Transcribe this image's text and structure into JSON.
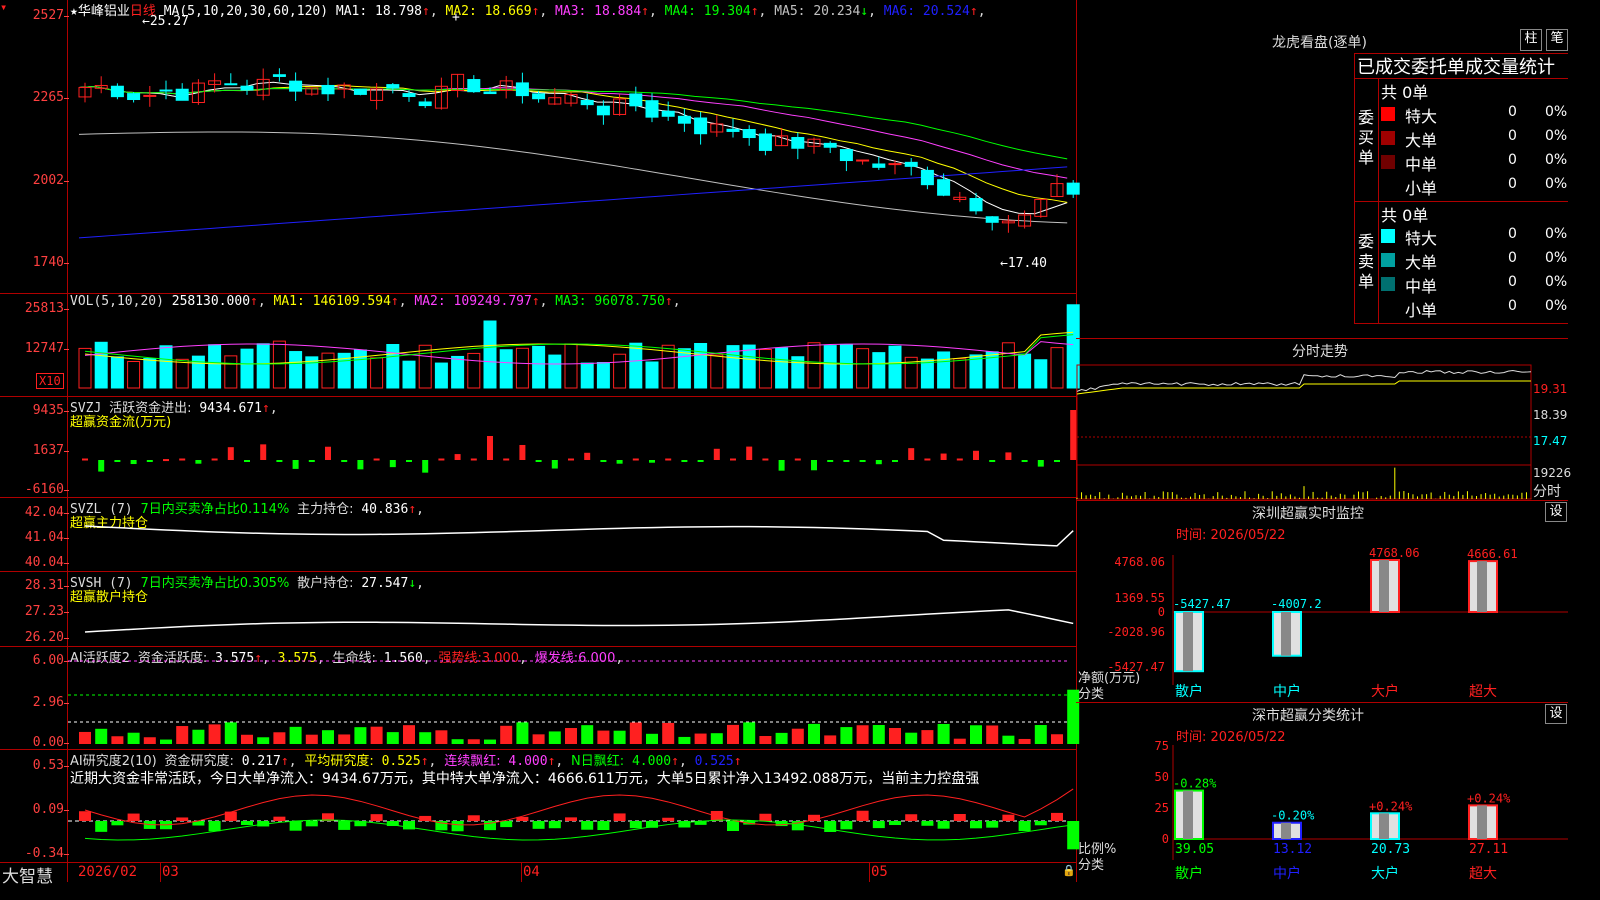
{
  "stock": {
    "name": "华峰铝业",
    "period": "日线",
    "star": "★"
  },
  "price_chart": {
    "ma_params": "MA(5,10,20,30,60,120)",
    "ma": [
      {
        "label": "MA1:",
        "value": "18.798",
        "arrow": "↑",
        "color": "#ffffff"
      },
      {
        "label": "MA2:",
        "value": "18.669",
        "arrow": "↑",
        "color": "#ffff00"
      },
      {
        "label": "MA3:",
        "value": "18.884",
        "arrow": "↑",
        "color": "#ff40ff"
      },
      {
        "label": "MA4:",
        "value": "19.304",
        "arrow": "↑",
        "color": "#00ff00"
      },
      {
        "label": "MA5:",
        "value": "20.234",
        "arrow": "↓",
        "color": "#c0c0c0"
      },
      {
        "label": "MA6:",
        "value": "20.524",
        "arrow": "↑",
        "color": "#2020ff"
      }
    ],
    "y_ticks": [
      "2527",
      "2265",
      "2002",
      "1740"
    ],
    "high_note": "←25.27",
    "low_note": "←17.40"
  },
  "volume": {
    "title": "VOL(5,10,20)",
    "value": "258130.000",
    "ma": [
      {
        "label": "MA1:",
        "value": "146109.594",
        "arrow": "↑",
        "color": "#ffff00"
      },
      {
        "label": "MA2:",
        "value": "109249.797",
        "arrow": "↑",
        "color": "#ff40ff"
      },
      {
        "label": "MA3:",
        "value": "96078.750",
        "arrow": "↑",
        "color": "#00ff00"
      }
    ],
    "y_ticks": [
      "25813",
      "12747"
    ],
    "unit": "X10"
  },
  "svzj": {
    "title": "SVZJ",
    "label": "活跃资金进出:",
    "value": "9434.671",
    "arrow": "↑",
    "sub": "超赢资金流(万元)",
    "y_ticks": [
      "9435",
      "1637",
      "-6160"
    ]
  },
  "svzl": {
    "title": "SVZL (7)",
    "label1": "7日内买卖净占比0.114%",
    "label2": "主力持仓:",
    "value": "40.836",
    "arrow": "↑",
    "sub": "超赢主力持仓",
    "y_ticks": [
      "42.04",
      "41.04",
      "40.04"
    ]
  },
  "svsh": {
    "title": "SVSH (7)",
    "label1": "7日内买卖净占比0.305%",
    "label2": "散户持仓:",
    "value": "27.547",
    "arrow": "↓",
    "sub": "超赢散户持仓",
    "y_ticks": [
      "28.31",
      "27.23",
      "26.20"
    ]
  },
  "ai_active": {
    "title": "AI活跃度2",
    "label": "资金活跃度:",
    "v1": "3.575",
    "v2": "3.575",
    "life_label": "生命线:",
    "life": "1.560",
    "strong": "强势线:3.000",
    "burst": "爆发线:6.000",
    "y_ticks": [
      "6.00",
      "2.96",
      "0.00"
    ]
  },
  "ai_research": {
    "title": "AI研究度2(10)",
    "label": "资金研究度:",
    "v1": "0.217",
    "avg_label": "平均研究度:",
    "avg": "0.525",
    "cont_label": "连续飘红:",
    "cont": "4.000",
    "n_label": "N日飘红:",
    "n": "4.000",
    "last": "0.525",
    "comment": "近期大资金非常活跃，今日大单净流入：9434.67万元，其中特大单净流入：4666.611万元，大单5日累计净入13492.088万元，当前主力控盘强",
    "y_ticks": [
      "0.53",
      "0.09",
      "-0.34"
    ]
  },
  "x_axis": {
    "brand": "大智慧",
    "labels": [
      "2026/02",
      "03",
      "04",
      "05"
    ]
  },
  "right_panel": {
    "title": "龙虎看盘(逐单)",
    "btn_bar": "柱",
    "btn_pen": "笔",
    "header": "已成交委托单成交量统计",
    "buy_label": "委买单",
    "sell_label": "委卖单",
    "buy_total": "共 0单",
    "sell_total": "共 0单",
    "buy_rows": [
      {
        "name": "特大",
        "v": "0",
        "p": "0%",
        "color": "#ff0000"
      },
      {
        "name": "大单",
        "v": "0",
        "p": "0%",
        "color": "#a00000"
      },
      {
        "name": "中单",
        "v": "0",
        "p": "0%",
        "color": "#700000"
      },
      {
        "name": "小单",
        "v": "0",
        "p": "0%",
        "color": "#000000"
      }
    ],
    "sell_rows": [
      {
        "name": "特大",
        "v": "0",
        "p": "0%",
        "color": "#00ffff"
      },
      {
        "name": "大单",
        "v": "0",
        "p": "0%",
        "color": "#00a0a0"
      },
      {
        "name": "中单",
        "v": "0",
        "p": "0%",
        "color": "#007070"
      },
      {
        "name": "小单",
        "v": "0",
        "p": "0%",
        "color": "#000000"
      }
    ],
    "intraday_title": "分时走势",
    "intraday_ticks": [
      "19.31",
      "18.39",
      "17.47",
      "19226"
    ],
    "intraday_label": "分时",
    "monitor_title": "深圳超赢实时监控",
    "settings": "设",
    "time_label": "时间:",
    "time": "2026/05/22",
    "monitor_ticks": [
      "4768.06",
      "1369.55",
      "0",
      "-2028.96",
      "-5427.47"
    ],
    "monitor_values": [
      {
        "cat": "散户",
        "v": -5427.47,
        "label": "-5427.47"
      },
      {
        "cat": "中户",
        "v": -4007.2,
        "label": "-4007.2"
      },
      {
        "cat": "大户",
        "v": 4768.06,
        "label": "4768.06"
      },
      {
        "cat": "超大",
        "v": 4666.61,
        "label": "4666.61"
      }
    ],
    "net_label": "净额(万元)",
    "class_label": "分类",
    "class_title": "深市超赢分类统计",
    "class_ticks": [
      "75",
      "50",
      "25",
      "0"
    ],
    "class_values": [
      {
        "cat": "散户",
        "v": 39.05,
        "label": "39.05",
        "pct": "-0.28%",
        "color": "#00ff00"
      },
      {
        "cat": "中户",
        "v": 13.12,
        "label": "13.12",
        "pct": "-0.20%",
        "color": "#2020ff"
      },
      {
        "cat": "大户",
        "v": 20.73,
        "label": "20.73",
        "pct": "+0.24%",
        "color": "#00ffff"
      },
      {
        "cat": "超大",
        "v": 27.11,
        "label": "27.11",
        "pct": "+0.24%",
        "color": "#ff2020"
      }
    ],
    "ratio_label": "比例%"
  }
}
